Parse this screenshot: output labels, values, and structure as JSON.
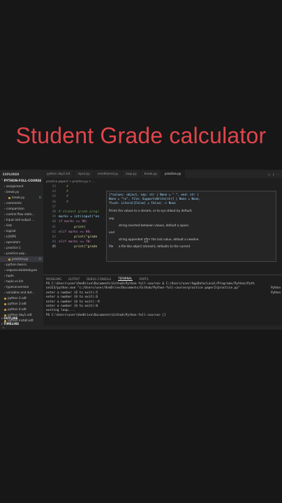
{
  "title": "Student Grade calculator",
  "tabs": {
    "explorer_title": "EXPLORER",
    "items": [
      "python day1.txt",
      "input.py",
      "conditional.py",
      "loop.py",
      "break.py",
      "practice.py"
    ],
    "active_index": 5
  },
  "breadcrumb": "practice paper2 > practice.py > ...",
  "sidebar": {
    "root": "PYTHON-FULL-COURSE",
    "items": [
      {
        "label": "assignment",
        "type": "folder"
      },
      {
        "label": "break.py",
        "type": "folder"
      },
      {
        "label": "break.py",
        "type": "file",
        "badge": "U"
      },
      {
        "label": "comments",
        "type": "folder"
      },
      {
        "label": "comparision",
        "type": "folder"
      },
      {
        "label": "control flow state...",
        "type": "folder"
      },
      {
        "label": "Input and output ...",
        "type": "folder"
      },
      {
        "label": "lists",
        "type": "folder"
      },
      {
        "label": "logical",
        "type": "folder"
      },
      {
        "label": "LOOPS",
        "type": "folder"
      },
      {
        "label": "operators",
        "type": "folder"
      },
      {
        "label": "practice 1",
        "type": "folder"
      },
      {
        "label": "practice pap...",
        "type": "folder"
      },
      {
        "label": "practice.py",
        "type": "file",
        "badge": "U"
      },
      {
        "label": "python basics",
        "type": "folder"
      },
      {
        "label": "sequence&datatypes",
        "type": "folder"
      },
      {
        "label": "tuple",
        "type": "folder"
      },
      {
        "label": "tuple vs list",
        "type": "folder"
      },
      {
        "label": "typeconversion",
        "type": "folder"
      },
      {
        "label": "variables and dat...",
        "type": "folder"
      },
      {
        "label": "python 2.odt",
        "type": "file"
      },
      {
        "label": "python 3.odt",
        "type": "file"
      },
      {
        "label": "python 4.odt",
        "type": "file"
      },
      {
        "label": "python day1.odt",
        "type": "file"
      },
      {
        "label": "python install.odt",
        "type": "file"
      }
    ],
    "outline": "OUTLINE",
    "timeline": "TIMELINE"
  },
  "code": {
    "lines": [
      {
        "n": "33",
        "text": "    #"
      },
      {
        "n": "34",
        "text": "    #"
      },
      {
        "n": "35",
        "text": "    #"
      },
      {
        "n": "36",
        "text": "    #"
      },
      {
        "n": "37",
        "text": ""
      },
      {
        "n": "38",
        "text": "# student grade progr"
      },
      {
        "n": "39",
        "text": "marks = int(input(\"en"
      },
      {
        "n": "40",
        "text": "if marks >= 90:"
      },
      {
        "n": "41",
        "text": "        print("
      },
      {
        "n": "42",
        "text": "elif marks >= 80:"
      },
      {
        "n": "43",
        "text": "        print(\"grade"
      },
      {
        "n": "44",
        "text": "elif marks >= 70:"
      },
      {
        "n": "45",
        "text": "        print(\"grade "
      }
    ],
    "current_line_index": 12
  },
  "hover": {
    "signature": "(*values: object, sep: str | None = \" \", end: str |\nNone = \"\\n\", file: SupportsWrite[str] | None = None,\nflush: Literal[False] = False) -> None",
    "doc": "Prints the values to a stream, or to sys.stdout by default.",
    "params": [
      {
        "name": "sep",
        "desc": ""
      },
      {
        "name": "",
        "desc": "string inserted between values, default a space."
      },
      {
        "name": "end",
        "desc": ""
      },
      {
        "name": "",
        "desc": "string appended after the last value, default a newline."
      },
      {
        "name": "file",
        "desc": "a file-like object (stream); defaults to the current"
      }
    ],
    "counter": "1/2"
  },
  "panel": {
    "tabs": [
      "PROBLEMS",
      "OUTPUT",
      "DEBUG CONSOLE",
      "TERMINAL",
      "PORTS"
    ],
    "active_index": 3,
    "lines": [
      "PS C:\\Users\\user\\OneDrive\\Documents\\Github\\Python-full-course> & C:/Users/user/AppData/Local/Programs/Python/Pyth",
      "on313/python.exe \"c:/Users/user/OneDrive/Documents/Github/Python-full-course/practice paper2/practice.py\"",
      "enter a number (0 to exit):5",
      "enter a number (0 to exit):6",
      "enter a number (0 to exit):-9",
      "enter a number (0 to exit):0",
      "exiting loop....",
      "PS C:\\Users\\user\\OneDrive\\Documents\\Github\\Python-full-course> []"
    ],
    "side": [
      "Python",
      "Python"
    ]
  }
}
